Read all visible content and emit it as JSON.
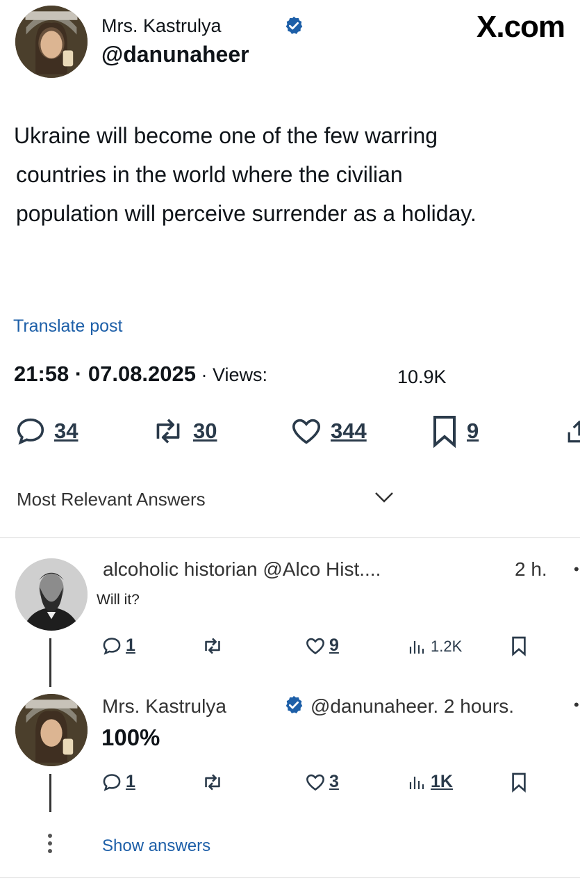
{
  "header": {
    "display_name": "Mrs. Kastrulya",
    "handle": "@danunaheer",
    "brand": "X.com"
  },
  "post": {
    "text_line1": "Ukraine will become one of the few warring",
    "text_line2": "countries in the world where the civilian",
    "text_line3": "population will perceive surrender as a holiday.",
    "translate_label": "Translate post",
    "time": "21:58",
    "date": "07.08.2025",
    "views_label": "Views:",
    "views_count": "10.9K",
    "replies": "34",
    "reposts": "30",
    "likes": "344",
    "bookmarks": "9"
  },
  "answers": {
    "sort_label": "Most Relevant Answers"
  },
  "replies": [
    {
      "author_line": "alcoholic historian @Alco Hist....",
      "time": "2 h.",
      "text": "Will it?",
      "replies": "1",
      "likes": "9",
      "views": "1.2K"
    },
    {
      "name": "Mrs. Kastrulya",
      "handle_time": "@danunaheer. 2 hours.",
      "text": "100%",
      "replies": "1",
      "likes": "3",
      "views": "1K"
    }
  ],
  "show_answers_label": "Show answers",
  "colors": {
    "verified": "#1d5fa8",
    "link": "#1d5fa8",
    "text": "#0f1419"
  }
}
